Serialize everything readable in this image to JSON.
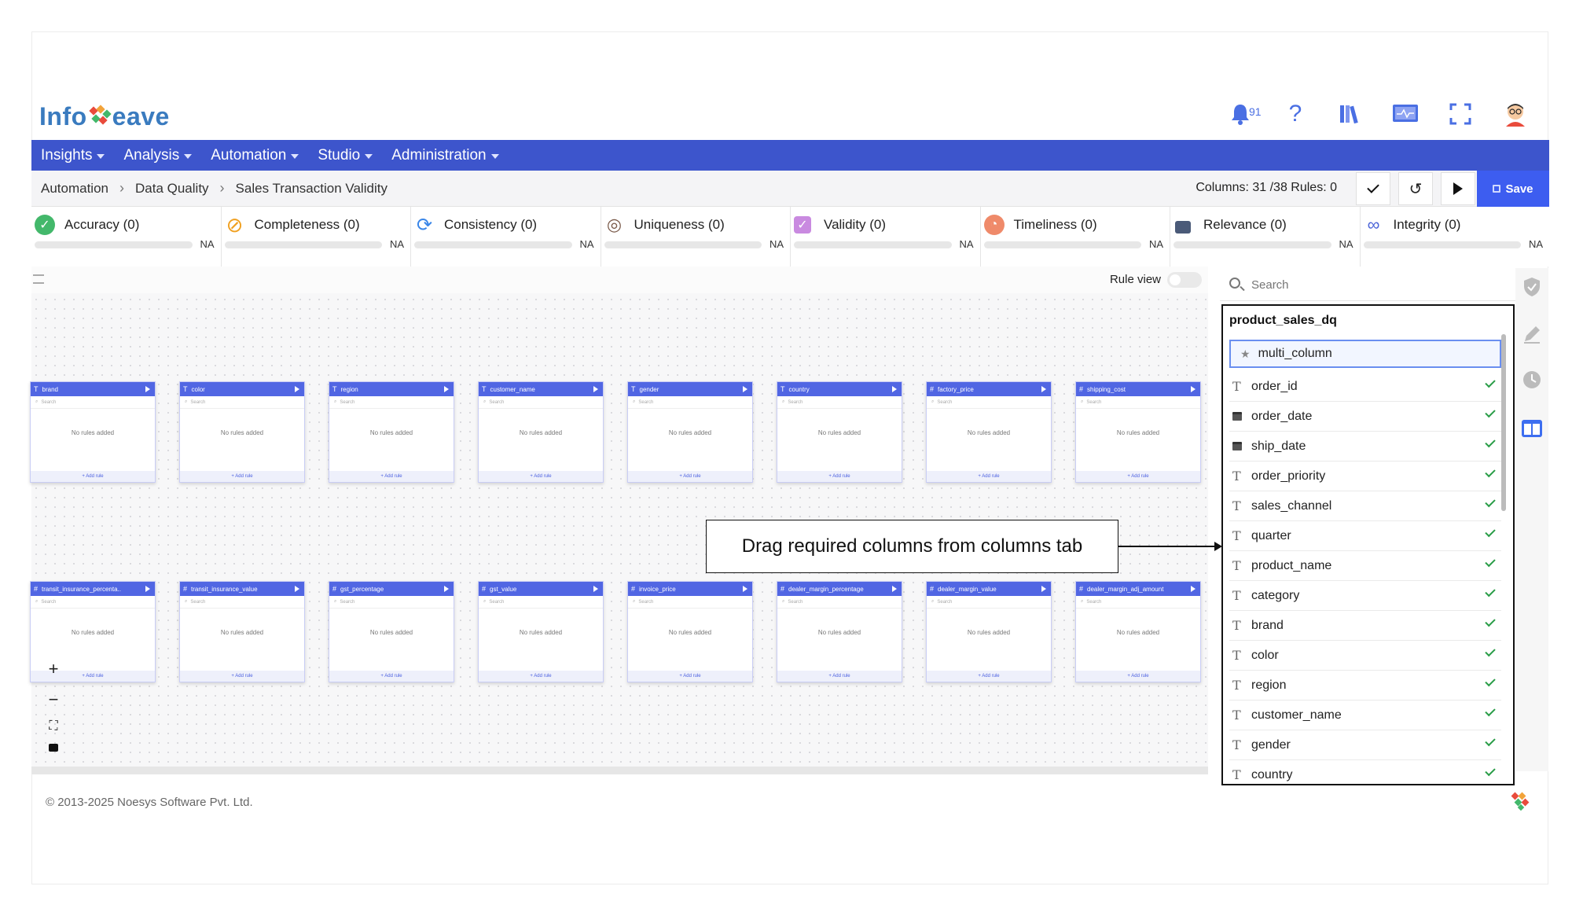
{
  "brand": {
    "left": "Info",
    "right": "eave"
  },
  "notifications": {
    "count": "91"
  },
  "nav": [
    {
      "label": "Insights"
    },
    {
      "label": "Analysis"
    },
    {
      "label": "Automation"
    },
    {
      "label": "Studio"
    },
    {
      "label": "Administration"
    }
  ],
  "breadcrumb": [
    "Automation",
    "Data Quality",
    "Sales Transaction Validity"
  ],
  "toolbar": {
    "columns_info": "Columns: 31 /38  Rules: 0",
    "save_label": "Save"
  },
  "dimensions": [
    {
      "label": "Accuracy (0)",
      "value": "NA",
      "color": "#43b86b",
      "icon": "check-circle-icon"
    },
    {
      "label": "Completeness (0)",
      "value": "NA",
      "color": "#f0a020",
      "icon": "slash-icon"
    },
    {
      "label": "Consistency (0)",
      "value": "NA",
      "color": "#3a86e8",
      "icon": "refresh-icon"
    },
    {
      "label": "Uniqueness (0)",
      "value": "NA",
      "color": "#7a5a4a",
      "icon": "fingerprint-icon"
    },
    {
      "label": "Validity (0)",
      "value": "NA",
      "color": "#b05fd0",
      "icon": "checkbox-icon"
    },
    {
      "label": "Timeliness (0)",
      "value": "NA",
      "color": "#ef7a5a",
      "icon": "clock-icon"
    },
    {
      "label": "Relevance (0)",
      "value": "NA",
      "color": "#4a5a78",
      "icon": "lock-icon"
    },
    {
      "label": "Integrity (0)",
      "value": "NA",
      "color": "#4a63d8",
      "icon": "link-icon"
    }
  ],
  "canvas": {
    "rule_view_label": "Rule view"
  },
  "node_common": {
    "search": "Search",
    "empty": "No rules added",
    "add": "+ Add rule"
  },
  "nodes_row1": [
    {
      "type": "T",
      "name": "brand"
    },
    {
      "type": "T",
      "name": "color"
    },
    {
      "type": "T",
      "name": "region"
    },
    {
      "type": "T",
      "name": "customer_name"
    },
    {
      "type": "T",
      "name": "gender"
    },
    {
      "type": "T",
      "name": "country"
    },
    {
      "type": "#",
      "name": "factory_price"
    },
    {
      "type": "#",
      "name": "shipping_cost"
    }
  ],
  "nodes_row2": [
    {
      "type": "#",
      "name": "transit_insurance_percenta.."
    },
    {
      "type": "#",
      "name": "transit_insurance_value"
    },
    {
      "type": "#",
      "name": "gst_percentage"
    },
    {
      "type": "#",
      "name": "gst_value"
    },
    {
      "type": "#",
      "name": "invoice_price"
    },
    {
      "type": "#",
      "name": "dealer_margin_percentage"
    },
    {
      "type": "#",
      "name": "dealer_margin_value"
    },
    {
      "type": "#",
      "name": "dealer_margin_adj_amount"
    }
  ],
  "callout": "Drag required columns from columns tab",
  "panel": {
    "search_placeholder": "Search",
    "table_name": "product_sales_dq",
    "multi_column": "multi_column",
    "columns": [
      {
        "type": "T",
        "name": "order_id"
      },
      {
        "type": "date",
        "name": "order_date"
      },
      {
        "type": "date",
        "name": "ship_date"
      },
      {
        "type": "T",
        "name": "order_priority"
      },
      {
        "type": "T",
        "name": "sales_channel"
      },
      {
        "type": "T",
        "name": "quarter"
      },
      {
        "type": "T",
        "name": "product_name"
      },
      {
        "type": "T",
        "name": "category"
      },
      {
        "type": "T",
        "name": "brand"
      },
      {
        "type": "T",
        "name": "color"
      },
      {
        "type": "T",
        "name": "region"
      },
      {
        "type": "T",
        "name": "customer_name"
      },
      {
        "type": "T",
        "name": "gender"
      },
      {
        "type": "T",
        "name": "country"
      }
    ]
  },
  "footer": "© 2013-2025 Noesys Software Pvt. Ltd."
}
